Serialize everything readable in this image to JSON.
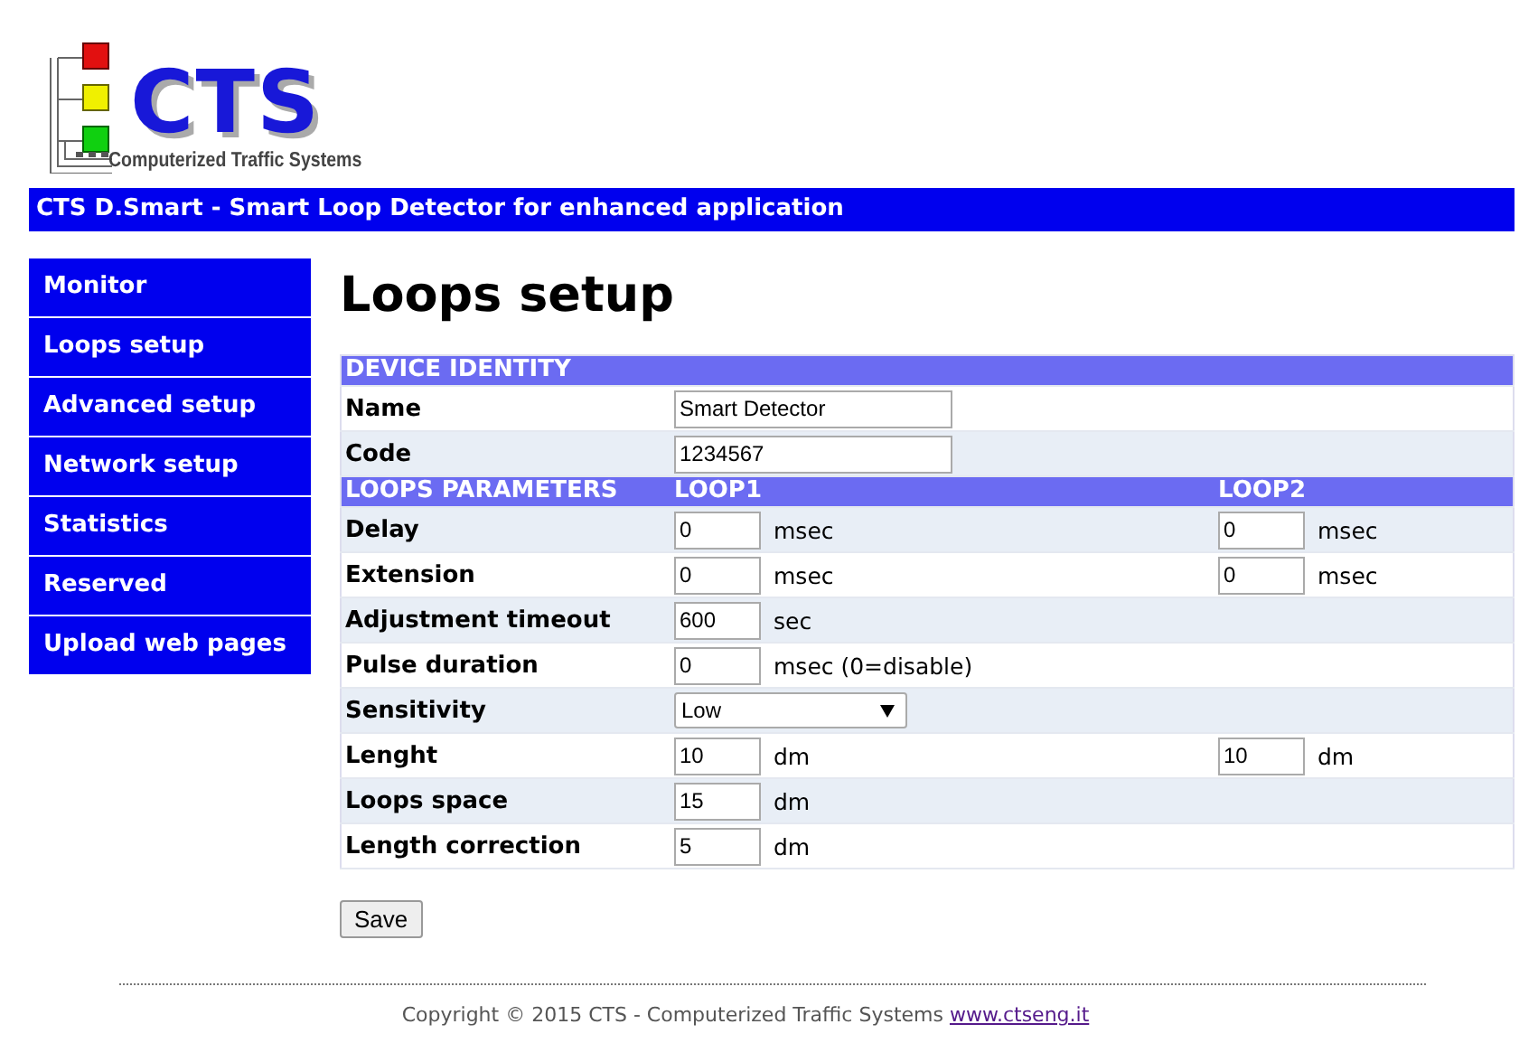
{
  "logo": {
    "mark": "CTS",
    "tagline": "Computerized Traffic Systems"
  },
  "header": {
    "title": "CTS D.Smart - Smart Loop Detector for enhanced application"
  },
  "sidebar": {
    "items": [
      {
        "label": "Monitor"
      },
      {
        "label": "Loops setup"
      },
      {
        "label": "Advanced setup"
      },
      {
        "label": "Network setup"
      },
      {
        "label": "Statistics"
      },
      {
        "label": "Reserved"
      },
      {
        "label": "Upload web pages"
      }
    ]
  },
  "page_title": "Loops setup",
  "sections": [
    {
      "columns": [
        "DEVICE IDENTITY"
      ],
      "rows": [
        {
          "kind": "text",
          "label": "Name",
          "value": "Smart Detector"
        },
        {
          "kind": "text",
          "label": "Code",
          "value": "1234567"
        }
      ]
    },
    {
      "columns": [
        "LOOPS PARAMETERS",
        "LOOP1",
        "LOOP2"
      ],
      "rows": [
        {
          "kind": "number",
          "label": "Delay",
          "loop1": {
            "value": "0",
            "unit": "msec"
          },
          "loop2": {
            "value": "0",
            "unit": "msec"
          }
        },
        {
          "kind": "number",
          "label": "Extension",
          "loop1": {
            "value": "0",
            "unit": "msec"
          },
          "loop2": {
            "value": "0",
            "unit": "msec"
          }
        },
        {
          "kind": "number",
          "label": "Adjustment timeout",
          "loop1": {
            "value": "600",
            "unit": "sec"
          }
        },
        {
          "kind": "number",
          "label": "Pulse duration",
          "loop1": {
            "value": "0",
            "unit": "msec (0=disable)"
          }
        },
        {
          "kind": "select",
          "label": "Sensitivity",
          "value": "Low"
        },
        {
          "kind": "number",
          "label": "Lenght",
          "loop1": {
            "value": "10",
            "unit": "dm"
          },
          "loop2": {
            "value": "10",
            "unit": "dm"
          }
        },
        {
          "kind": "number",
          "label": "Loops space",
          "loop1": {
            "value": "15",
            "unit": "dm"
          }
        },
        {
          "kind": "number",
          "label": "Length correction",
          "loop1": {
            "value": "5",
            "unit": "dm"
          }
        }
      ]
    }
  ],
  "save_button": "Save",
  "footer": {
    "copyright": "Copyright © 2015 CTS - Computerized Traffic Systems",
    "link": "www.ctseng.it"
  }
}
